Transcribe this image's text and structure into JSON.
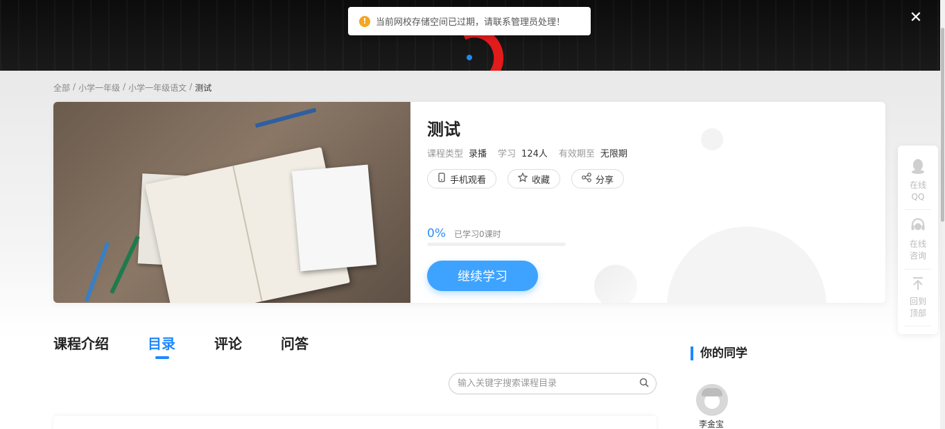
{
  "toast": {
    "icon": "warning-icon",
    "icon_glyph": "!",
    "message": "当前网校存储空间已过期，请联系管理员处理！",
    "accent": "#f5a623"
  },
  "banner": {
    "close_glyph": "✕",
    "dot_color": "#1e88ff"
  },
  "breadcrumb": {
    "items": [
      "全部",
      "/",
      "小学一年级",
      "/",
      "小学一年级语文",
      "/"
    ],
    "current": "测试"
  },
  "course": {
    "title": "测试",
    "type_label": "课程类型",
    "type_value": "录播",
    "study_label": "学习",
    "study_value": "124人",
    "validity_label": "有效期至",
    "validity_value": "无限期",
    "actions": {
      "mobile": "手机观看",
      "favorite": "收藏",
      "share": "分享"
    },
    "progress": {
      "percent_text": "0%",
      "detail": "已学习0课时",
      "fraction": 0
    },
    "continue_label": "继续学习",
    "accent": "#3ea3ff"
  },
  "tabs": [
    {
      "label": "课程介绍",
      "active": false
    },
    {
      "label": "目录",
      "active": true
    },
    {
      "label": "评论",
      "active": false
    },
    {
      "label": "问答",
      "active": false
    }
  ],
  "search": {
    "placeholder": "输入关键字搜索课程目录",
    "value": ""
  },
  "classmates": {
    "title": "你的同学",
    "people": [
      {
        "name": "李金宝"
      }
    ]
  },
  "sidebar": {
    "qq": "在线\nQQ",
    "consult": "在线\n咨询",
    "top": "回到\n顶部"
  }
}
